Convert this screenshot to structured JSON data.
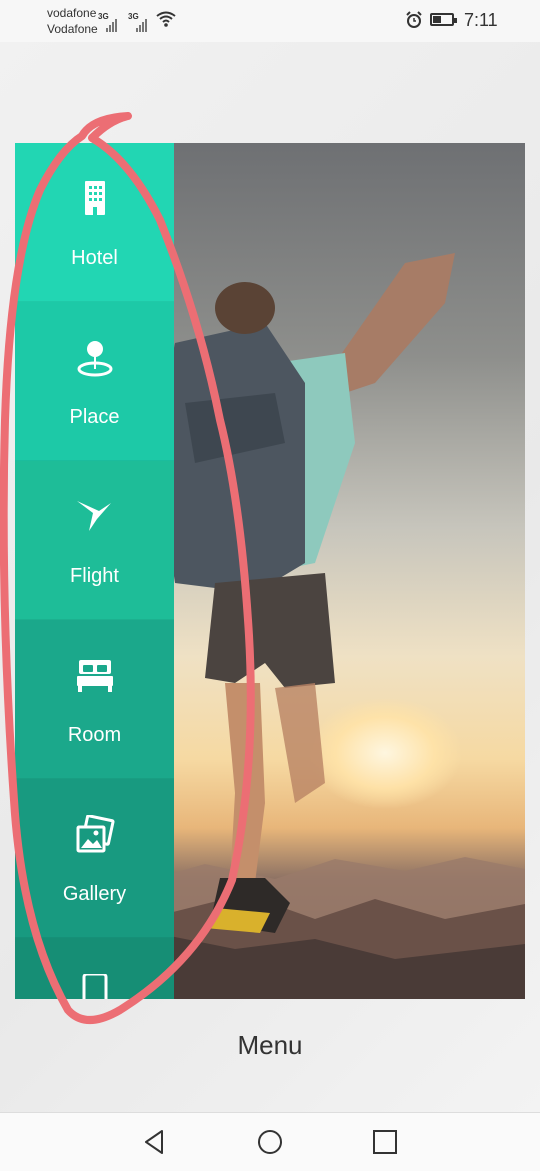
{
  "status": {
    "carrier_primary": "vodafone",
    "carrier_secondary": "Vodafone",
    "signal1_label": "3G",
    "signal2_label": "3G",
    "time": "7:11",
    "icons": [
      "signal-icon",
      "wifi-icon",
      "alarm-icon",
      "battery-icon"
    ]
  },
  "menu": {
    "items": [
      {
        "label": "Hotel",
        "icon": "hotel-icon",
        "color": "#22d6b3"
      },
      {
        "label": "Place",
        "icon": "place-icon",
        "color": "#1dc9a7"
      },
      {
        "label": "Flight",
        "icon": "flight-icon",
        "color": "#1ebd98"
      },
      {
        "label": "Room",
        "icon": "room-icon",
        "color": "#1ba88b"
      },
      {
        "label": "Gallery",
        "icon": "gallery-icon",
        "color": "#189a80"
      },
      {
        "label": "",
        "icon": "phone-icon",
        "color": "#168e75"
      }
    ]
  },
  "caption": "Menu",
  "annotation_color": "#ec6e74",
  "navigation": [
    "back-icon",
    "home-icon",
    "recent-apps-icon"
  ]
}
